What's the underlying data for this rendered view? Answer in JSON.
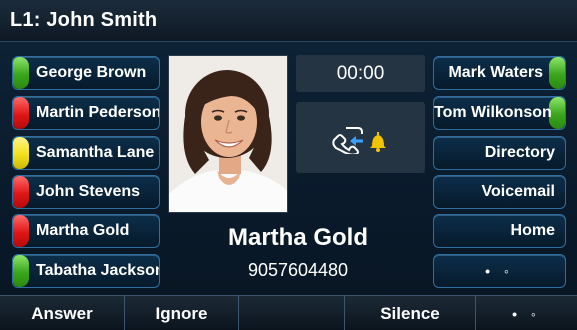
{
  "header": {
    "title": "L1: John Smith"
  },
  "left_keys": [
    {
      "label": "George Brown",
      "indicator": "green"
    },
    {
      "label": "Martin Pederson",
      "indicator": "red"
    },
    {
      "label": "Samantha Lane",
      "indicator": "yellow"
    },
    {
      "label": "John Stevens",
      "indicator": "red"
    },
    {
      "label": "Martha Gold",
      "indicator": "red"
    },
    {
      "label": "Tabatha Jackson",
      "indicator": "green"
    }
  ],
  "right_keys": [
    {
      "label": "Mark Waters",
      "indicator": "green"
    },
    {
      "label": "Tom Wilkonson",
      "indicator": "green"
    },
    {
      "label": "Directory",
      "indicator": "none"
    },
    {
      "label": "Voicemail",
      "indicator": "none"
    },
    {
      "label": "Home",
      "indicator": "none"
    },
    {
      "label": "• ◦",
      "indicator": "none"
    }
  ],
  "call": {
    "timer": "00:00",
    "status_icon": "incoming-call-ringing-icon",
    "caller_name": "Martha Gold",
    "caller_number": "9057604480",
    "photo": "caller-photo"
  },
  "softkeys": [
    "Answer",
    "Ignore",
    "",
    "Silence",
    "• ◦"
  ],
  "colors": {
    "green": "#3aa51c",
    "red": "#e01616",
    "yellow": "#f2e01c",
    "key_border": "#2f6f9f",
    "bell": "#f2c400",
    "arrow": "#3aa0ff"
  }
}
